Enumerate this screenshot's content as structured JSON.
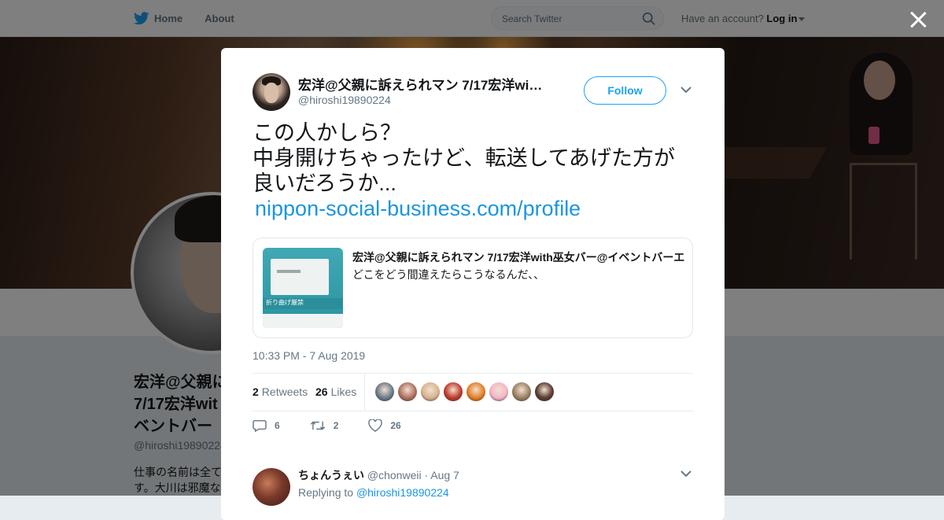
{
  "nav": {
    "home_label": "Home",
    "about_label": "About",
    "search_placeholder": "Search Twitter",
    "account_prompt": "Have an account?",
    "login_label": "Log in"
  },
  "background_profile": {
    "name": "宏洋@父親に訴えられマン 7/17宏洋with巫女バー@イベントバーエ",
    "name_visible": "宏洋@父親に 7/17宏洋wit ベントバー",
    "handle": "@hiroshi19890224",
    "bio": "仕事の名前は全て す。大川は邪魔な"
  },
  "tweet": {
    "author_name": "宏洋@父親に訴えられマン 7/17宏洋with巫女バー@イベントバーエ",
    "author_handle": "@hiroshi19890224",
    "follow_label": "Follow",
    "text_lines": [
      "この人かしら？",
      "中身開けちゃったけど、転送してあげた方が",
      "良いだろうか..."
    ],
    "link": "nippon-social-business.com/profile",
    "quoted": {
      "title": "宏洋@父親に訴えられマン 7/17宏洋with巫女バー@イベントバーエ",
      "description": "どこをどう間違えたらこうなるんだ、、",
      "image_label": "折り曲げ厳禁"
    },
    "timestamp": "10:33 PM - 7 Aug 2019",
    "retweets_count": "2",
    "retweets_label": "Retweets",
    "likes_count": "26",
    "likes_label": "Likes",
    "liker_avatar_colors": [
      "#6c7a89",
      "#b07060",
      "#d9b48f",
      "#c0392b",
      "#e67e22",
      "#f5b6c8",
      "#9c8064",
      "#5a3a30"
    ],
    "actions": {
      "reply_count": "6",
      "retweet_count": "2",
      "like_count": "26"
    }
  },
  "reply": {
    "name": "ちょんうぇい",
    "handle": "@chonweii",
    "date": "Aug 7",
    "replying_prefix": "Replying to",
    "replying_to": "@hiroshi19890224"
  },
  "colors": {
    "twitter_blue": "#1da1f2",
    "link_blue": "#1b95e0",
    "text_primary": "#14171a",
    "text_secondary": "#657786"
  }
}
